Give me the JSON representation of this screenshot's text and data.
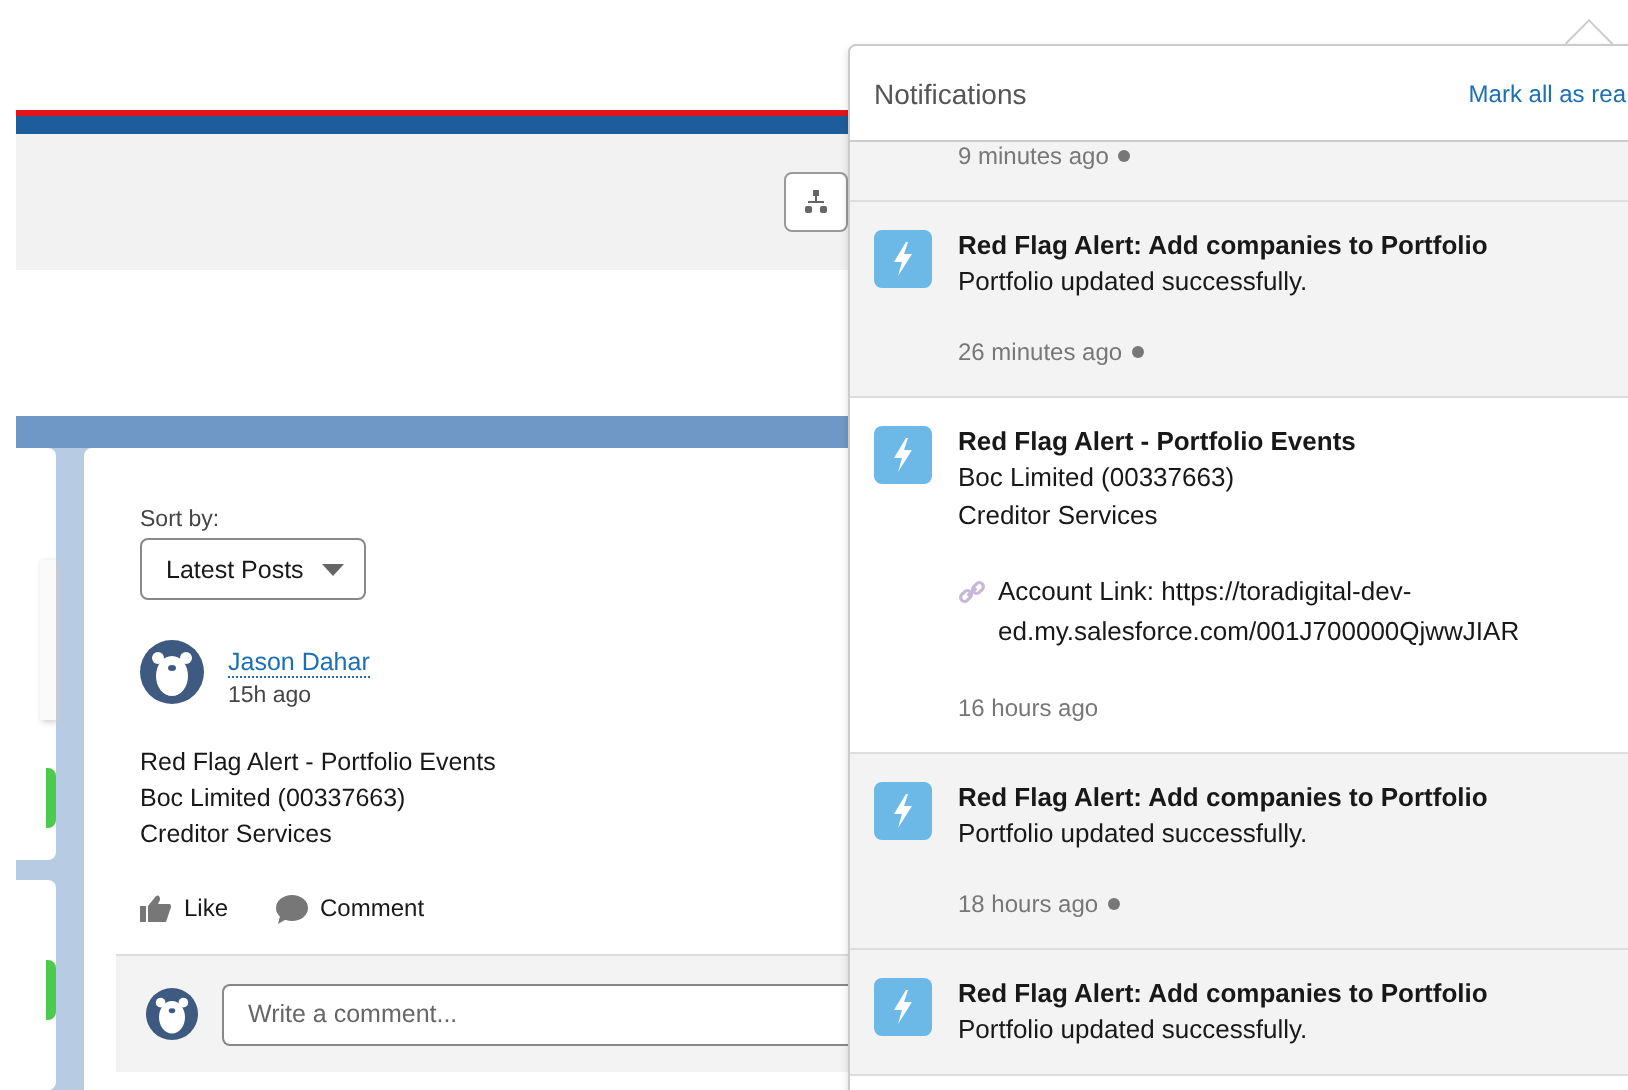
{
  "feed": {
    "sort_label": "Sort by:",
    "sort_value": "Latest Posts",
    "post": {
      "author": "Jason Dahar",
      "time": "15h ago",
      "lines": [
        "Red Flag Alert - Portfolio Events",
        "Boc Limited (00337663)",
        "Creditor Services"
      ],
      "actions": [
        "Like",
        "Comment"
      ]
    },
    "comment_placeholder": "Write a comment..."
  },
  "notifications": {
    "title": "Notifications",
    "mark_all": "Mark all as rea",
    "items": [
      {
        "time": "9 minutes ago",
        "unread": true
      },
      {
        "title": "Red Flag Alert: Add companies to Portfolio",
        "lines": [
          "Portfolio updated successfully."
        ],
        "time": "26 minutes ago",
        "unread": true
      },
      {
        "title": "Red Flag Alert - Portfolio Events",
        "lines": [
          "Boc Limited (00337663)",
          "Creditor Services"
        ],
        "link": "Account Link: https://toradigital-dev-ed.my.salesforce.com/001J700000QjwwJIAR",
        "time": "16 hours ago",
        "unread": false
      },
      {
        "title": "Red Flag Alert: Add companies to Portfolio",
        "lines": [
          "Portfolio updated successfully."
        ],
        "time": "18 hours ago",
        "unread": true
      },
      {
        "title": "Red Flag Alert: Add companies to Portfolio",
        "lines": [
          "Portfolio updated successfully."
        ],
        "unread": true
      }
    ]
  }
}
